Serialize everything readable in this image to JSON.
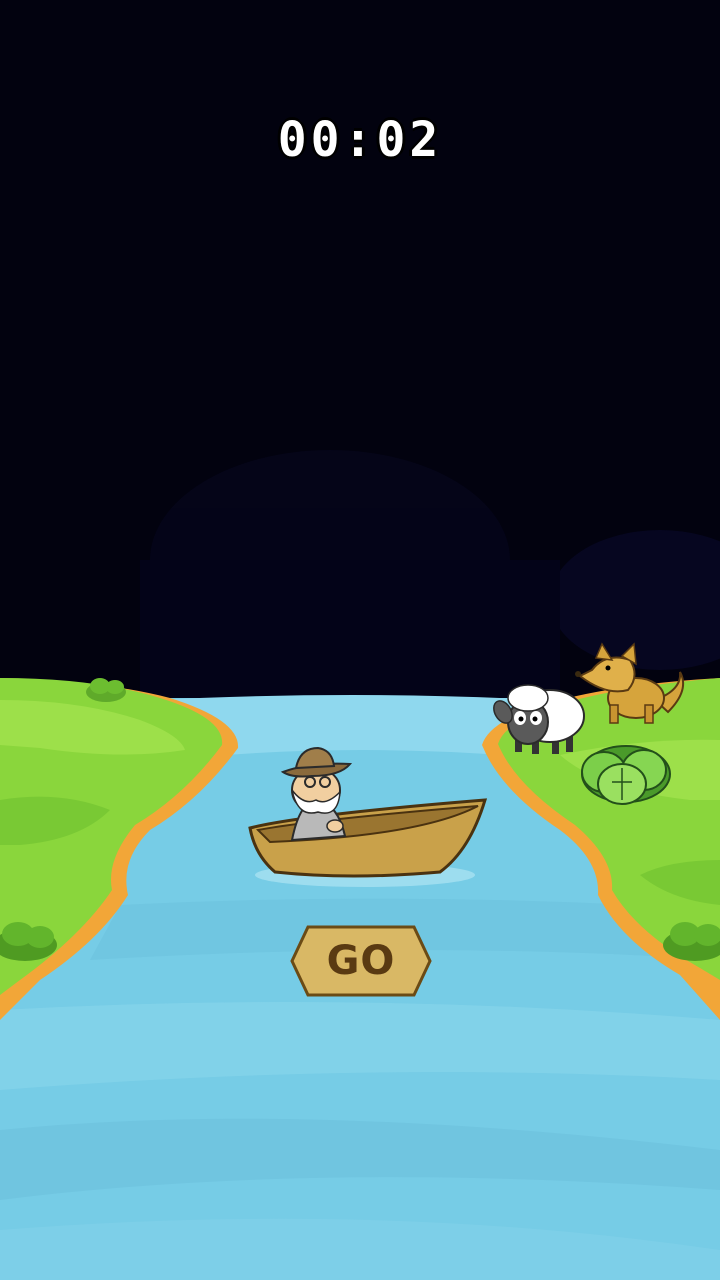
{
  "game": {
    "timer": "00:02",
    "go_label": "GO"
  },
  "characters": [
    "farmer",
    "sheep",
    "wolf",
    "cabbage"
  ],
  "colors": {
    "sky": "#02020f",
    "river": "#76cce6",
    "grass": "#8ad63c",
    "bank_edge": "#f2a638",
    "boat": "#c9a14a",
    "button_fill": "#d9b865",
    "button_text": "#5a3a12",
    "timer_text": "#ffffff"
  }
}
